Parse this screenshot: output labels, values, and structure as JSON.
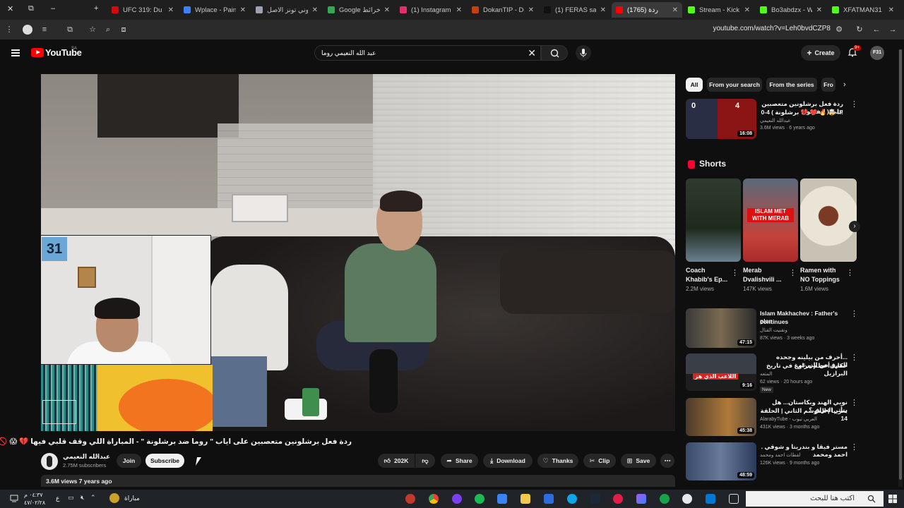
{
  "browser": {
    "tabs": [
      {
        "label": "UFC 319: Du Pl",
        "color": "#d20a0a"
      },
      {
        "label": "Wplace - Paint",
        "color": "#3b82f6"
      },
      {
        "label": "لوني تونز الاصل",
        "color": "#9ca3af"
      },
      {
        "label": "Google خرائط",
        "color": "#34a853"
      },
      {
        "label": "(1) Instagram",
        "color": "#e1306c"
      },
      {
        "label": "DokanTIP - Do",
        "color": "#c2410c"
      },
      {
        "label": "(1) FERAS sa",
        "color": "#111111"
      },
      {
        "label": "(1765) ردة",
        "color": "#ff0000"
      },
      {
        "label": "Stream - Kick l",
        "color": "#53fc18"
      },
      {
        "label": "Bo3abdzx - W",
        "color": "#53fc18"
      },
      {
        "label": "XFATMAN31 St",
        "color": "#53fc18"
      }
    ],
    "active_tab_index": 7,
    "url": "youtube.com/watch?v=Leh0bvdCZP8"
  },
  "header": {
    "logo_text": "YouTube",
    "country_code": "SA",
    "search_value": "عبد الله النعيمي روما",
    "create_label": "Create",
    "notifications_badge": "9+",
    "avatar_text": "F31"
  },
  "video": {
    "title": "ردة فعل برشلونين متعصبين على اياب \" روما ضد برشلونة \" - المباراة اللي وقف قلبي فيها 💔 😱 🚫 🔥 !!!",
    "facecam_number": "31",
    "channel_name": "عبدالله النعيمي",
    "channel_verified": "✔",
    "subscribers": "2.75M subscribers",
    "join_label": "Join",
    "subscribe_label": "Subscribe",
    "likes": "202K",
    "share_label": "Share",
    "download_label": "Download",
    "thanks_label": "Thanks",
    "clip_label": "Clip",
    "save_label": "Save",
    "views_date": "3.6M views  7 years ago"
  },
  "sidebar": {
    "chips": [
      "All",
      "From your search",
      "From the series",
      "Fro"
    ],
    "top_video": {
      "title_line1": "ردة فعل برشلونين متعصبين على ( ليفربول",
      "title_line2": "!!! 🤯 🔥 ❤️ 💔 برشلونة ) 4-0",
      "channel": "عبدالله النعيمي",
      "meta": "3.6M views · 6 years ago",
      "duration": "16:08",
      "score_left": "0",
      "score_right": "4"
    },
    "shorts_heading": "Shorts",
    "shorts": [
      {
        "title_l1": "Coach",
        "title_l2": "Khabib's Ep...",
        "views": "2.2M views",
        "overlay": ""
      },
      {
        "title_l1": "Merab",
        "title_l2": "Dvalishvili ...",
        "views": "147K views",
        "overlay": "ISLAM MET WITH MERAB"
      },
      {
        "title_l1": "Ramen with",
        "title_l2": "NO Toppings",
        "views": "1.6M views",
        "overlay": ""
      }
    ],
    "videos": [
      {
        "title_l1": "Islam Makhachev : Father's plan",
        "title_l2": "continues",
        "channel": "ونقنيت القتال",
        "meta": "87K views · 3 weeks ago",
        "duration": "47:15",
        "new": ""
      },
      {
        "title_l1": "...أحرف من بيلينه وجحده المرق من الزرعي",
        "title_l2": "حكاية أعظم مراوغ في تاريخ البرازيل",
        "channel": "المتعه",
        "meta": "62 views · 20 hours ago",
        "duration": "9:16",
        "new": "New",
        "overlay": "اللاعب الذي هز"
      },
      {
        "title_l1": "نويي الهند وبكاستان... هل يتأثر العراق ؟",
        "title_l2": "تعريبا | الموسم الثاني | الحلقة 14",
        "channel": "AlarabyTube - العربي تيوب",
        "meta": "431K views · 3 months ago",
        "duration": "45:38",
        "new": ""
      },
      {
        "title_l1": "مستر فيقا و بندريتا و شوقي . احمد ومحمد",
        "title_l2": "",
        "channel": "لقطات احمد ومحمد",
        "meta": "126K views · 9 months ago",
        "duration": "48:59",
        "new": ""
      }
    ]
  },
  "taskbar": {
    "clock_time": "٠٤:٣٧ م",
    "clock_date": "٤٧/٠٢/٢٨",
    "language": "ع",
    "weather": "مباراة",
    "search_placeholder": "اكتب هنا للبحث"
  }
}
